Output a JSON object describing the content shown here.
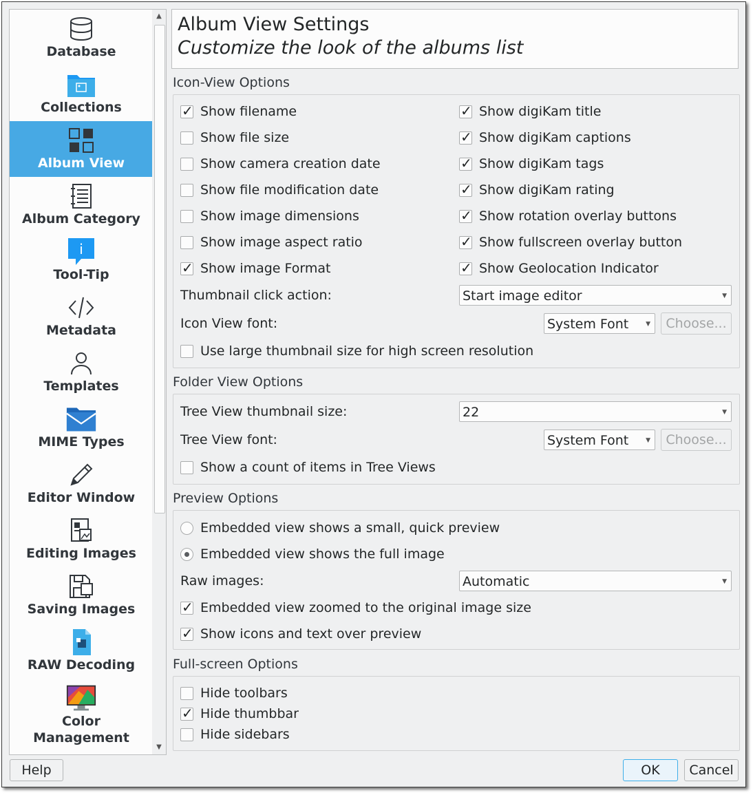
{
  "sidebar": {
    "items": [
      {
        "label": "Database",
        "icon": "database-icon"
      },
      {
        "label": "Collections",
        "icon": "folder-image-icon"
      },
      {
        "label": "Album View",
        "icon": "grid-view-icon",
        "selected": true
      },
      {
        "label": "Album Category",
        "icon": "notebook-icon"
      },
      {
        "label": "Tool-Tip",
        "icon": "info-balloon-icon"
      },
      {
        "label": "Metadata",
        "icon": "code-icon"
      },
      {
        "label": "Templates",
        "icon": "user-icon"
      },
      {
        "label": "MIME Types",
        "icon": "mail-folder-icon"
      },
      {
        "label": "Editor Window",
        "icon": "pencil-icon"
      },
      {
        "label": "Editing Images",
        "icon": "document-image-icon"
      },
      {
        "label": "Saving Images",
        "icon": "save-icon"
      },
      {
        "label": "RAW Decoding",
        "icon": "raw-document-icon"
      },
      {
        "label": "Color\nManagement",
        "line1": "Color",
        "line2": "Management",
        "icon": "monitor-color-icon"
      }
    ]
  },
  "header": {
    "title": "Album View Settings",
    "subtitle": "Customize the look of the albums list"
  },
  "icon_view": {
    "title": "Icon-View Options",
    "left": [
      {
        "label": "Show filename",
        "checked": true
      },
      {
        "label": "Show file size",
        "checked": false
      },
      {
        "label": "Show camera creation date",
        "checked": false
      },
      {
        "label": "Show file modification date",
        "checked": false
      },
      {
        "label": "Show image dimensions",
        "checked": false
      },
      {
        "label": "Show image aspect ratio",
        "checked": false
      },
      {
        "label": "Show image Format",
        "checked": true
      }
    ],
    "right": [
      {
        "label": "Show digiKam title",
        "checked": true
      },
      {
        "label": "Show digiKam captions",
        "checked": true
      },
      {
        "label": "Show digiKam tags",
        "checked": true
      },
      {
        "label": "Show digiKam rating",
        "checked": true
      },
      {
        "label": "Show rotation overlay buttons",
        "checked": true
      },
      {
        "label": "Show fullscreen overlay button",
        "checked": true
      },
      {
        "label": "Show Geolocation Indicator",
        "checked": true
      }
    ],
    "click_action_label": "Thumbnail click action:",
    "click_action_value": "Start image editor",
    "font_label": "Icon View font:",
    "font_value": "System Font",
    "choose_label": "Choose...",
    "large_thumb_label": "Use large thumbnail size for high screen resolution",
    "large_thumb_checked": false
  },
  "folder_view": {
    "title": "Folder View Options",
    "thumb_size_label": "Tree View thumbnail size:",
    "thumb_size_value": "22",
    "font_label": "Tree View font:",
    "font_value": "System Font",
    "choose_label": "Choose...",
    "count_label": "Show a count of items in Tree Views",
    "count_checked": false
  },
  "preview": {
    "title": "Preview Options",
    "radio_small": "Embedded view shows a small, quick preview",
    "radio_full": "Embedded view shows the full image",
    "selected": "full",
    "raw_label": "Raw images:",
    "raw_value": "Automatic",
    "zoomed_label": "Embedded view zoomed to the original image size",
    "zoomed_checked": true,
    "icons_text_label": "Show icons and text over preview",
    "icons_text_checked": true
  },
  "fullscreen": {
    "title": "Full-screen Options",
    "items": [
      {
        "label": "Hide toolbars",
        "checked": false
      },
      {
        "label": "Hide thumbbar",
        "checked": true
      },
      {
        "label": "Hide sidebars",
        "checked": false
      }
    ]
  },
  "buttons": {
    "help": "Help",
    "ok": "OK",
    "cancel": "Cancel"
  },
  "colors": {
    "accent": "#47a9e4",
    "window_bg": "#eff0f1",
    "panel_bg": "#fcfcfc"
  }
}
